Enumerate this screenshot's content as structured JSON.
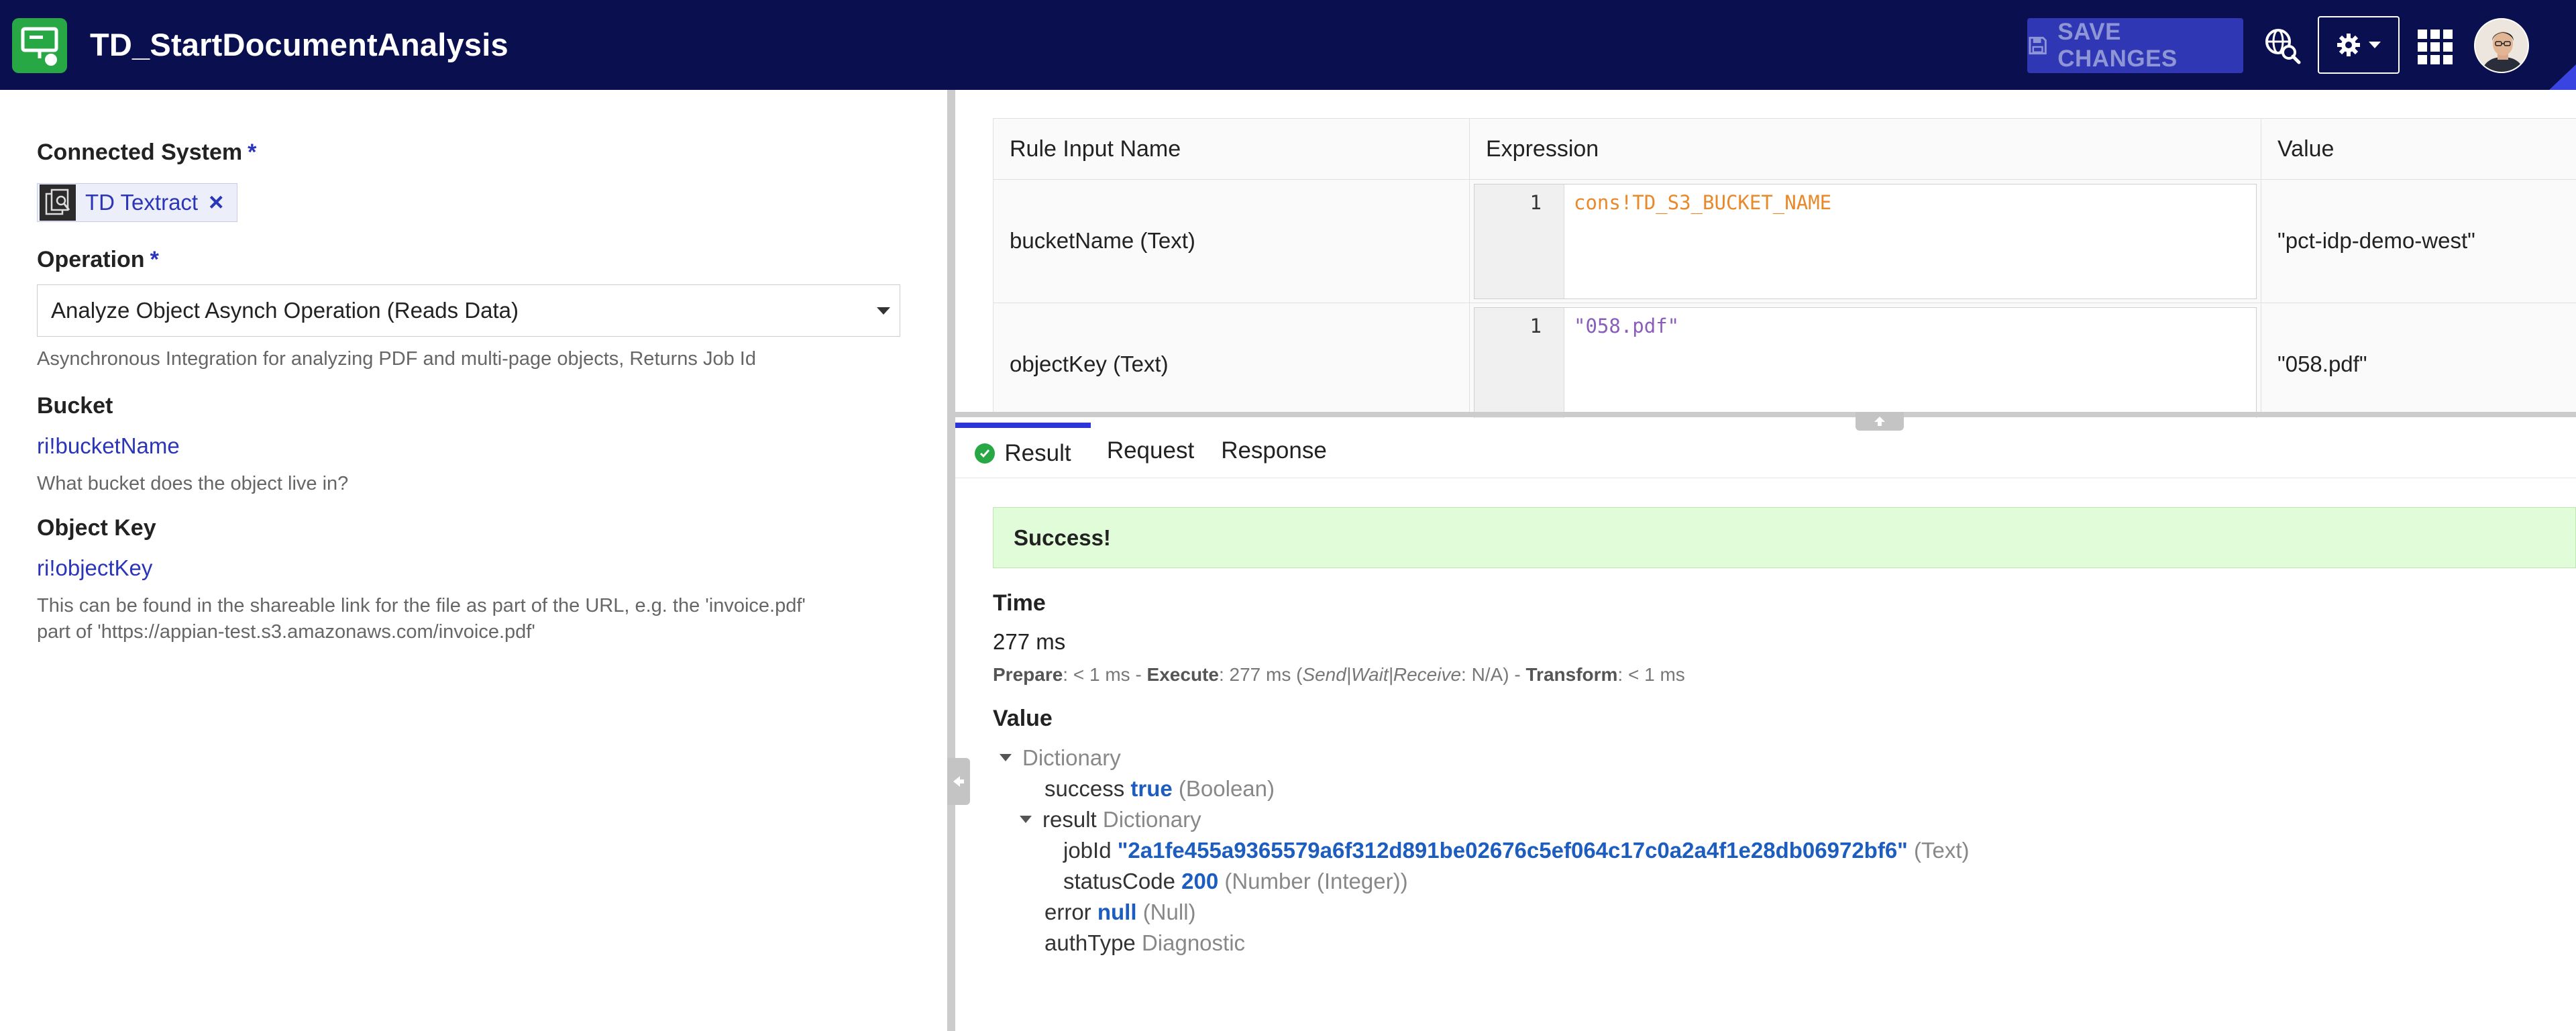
{
  "header": {
    "title": "TD_StartDocumentAnalysis",
    "save_label": "SAVE CHANGES",
    "colors": {
      "bar": "#0a0f4f",
      "logo": "#28a745",
      "save_button": "#2f37b4"
    }
  },
  "config": {
    "connected_system": {
      "label": "Connected System",
      "required_mark": "*",
      "value": "TD Textract"
    },
    "operation": {
      "label": "Operation",
      "required_mark": "*",
      "value": "Analyze Object Asynch Operation (Reads Data)",
      "help": "Asynchronous Integration for analyzing PDF and multi-page objects, Returns Job Id"
    },
    "bucket": {
      "label": "Bucket",
      "value": "ri!bucketName",
      "help": "What bucket does the object live in?"
    },
    "object_key": {
      "label": "Object Key",
      "value": "ri!objectKey",
      "help_line1": "This can be found in the shareable link for the file as part of the URL, e.g. the 'invoice.pdf'",
      "help_line2": "part of 'https://appian-test.s3.amazonaws.com/invoice.pdf'"
    }
  },
  "rule_inputs": {
    "columns": [
      "Rule Input Name",
      "Expression",
      "Value"
    ],
    "rows": [
      {
        "name": "bucketName (Text)",
        "line": "1",
        "expression": "cons!TD_S3_BUCKET_NAME",
        "value": "\"pct-idp-demo-west\""
      },
      {
        "name": "objectKey (Text)",
        "line": "1",
        "expression": "\"058.pdf\"",
        "value": "\"058.pdf\""
      }
    ]
  },
  "tabs": [
    {
      "label": "Result",
      "active": true
    },
    {
      "label": "Request",
      "active": false
    },
    {
      "label": "Response",
      "active": false
    }
  ],
  "result": {
    "banner": "Success!",
    "time_label": "Time",
    "time_value": "277 ms",
    "timing": {
      "prepare_label": "Prepare",
      "prepare_value": ": < 1 ms - ",
      "execute_label": "Execute",
      "execute_value": ": 277 ms (",
      "execute_detail": "Send|Wait|Receive",
      "execute_detail_value": ": N/A) - ",
      "transform_label": "Transform",
      "transform_value": ": < 1 ms"
    },
    "value_label": "Value",
    "tree": {
      "root_type": "Dictionary",
      "success_key": "success",
      "success_value": "true",
      "success_type": "(Boolean)",
      "result_key": "result",
      "result_type": "Dictionary",
      "jobid_key": "jobId",
      "jobid_value": "\"2a1fe455a9365579a6f312d891be02676c5ef064c17c0a2a4f1e28db06972bf6\"",
      "jobid_type": "(Text)",
      "status_key": "statusCode",
      "status_value": "200",
      "status_type": "(Number (Integer))",
      "error_key": "error",
      "error_value": "null",
      "error_type": "(Null)",
      "auth_key": "authType",
      "auth_type": "Diagnostic"
    }
  }
}
